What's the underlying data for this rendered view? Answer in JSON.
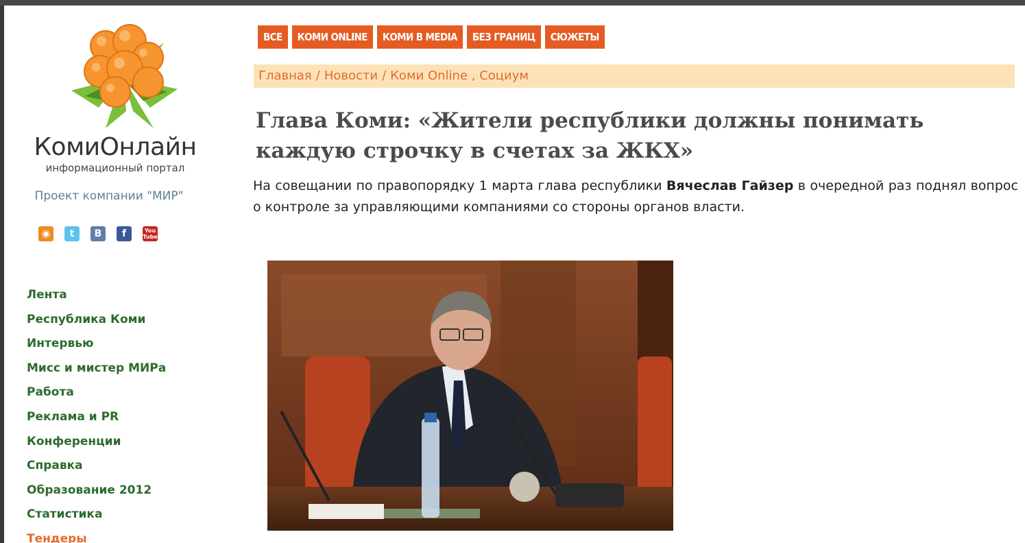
{
  "sidebar": {
    "brand": "КомиОнлайн",
    "tagline": "информационный портал",
    "project": "Проект компании \"МИР\"",
    "social": [
      {
        "icon": "rss-icon",
        "glyph": "◉"
      },
      {
        "icon": "twitter-icon",
        "glyph": "t"
      },
      {
        "icon": "vkontakte-icon",
        "glyph": "B"
      },
      {
        "icon": "facebook-icon",
        "glyph": "f"
      },
      {
        "icon": "youtube-icon",
        "glyph": "You Tube"
      }
    ],
    "menu": [
      "Лента",
      "Республика Коми",
      "Интервью",
      "Мисс и мистер МИРа",
      "Работа",
      "Реклама и PR",
      "Конференции",
      "Справка",
      "Образование 2012",
      "Статистика",
      "Тендеры"
    ]
  },
  "tabs": [
    "ВСЕ",
    "КОМИ ONLINE",
    "КОМИ В MEDIA",
    "БЕЗ ГРАНИЦ",
    "СЮЖЕТЫ"
  ],
  "breadcrumb": {
    "home": "Главная",
    "news": "Новости",
    "section": "Коми Online",
    "tag": "Социум"
  },
  "article": {
    "title": "Глава Коми: «Жители республики должны понимать каждую строчку в счетах за ЖКХ»",
    "lead_before": "На совещании по правопорядку 1 марта глава республики ",
    "lead_name": "Вячеслав Гайзер",
    "lead_after": " в очередной раз поднял вопрос о контроле за управляющими компаниями со стороны органов власти."
  },
  "colors": {
    "accent": "#e45c23",
    "crumb_bg": "#fde2b8",
    "menu_green": "#2d6b2d",
    "menu_hot": "#e36b2a"
  }
}
